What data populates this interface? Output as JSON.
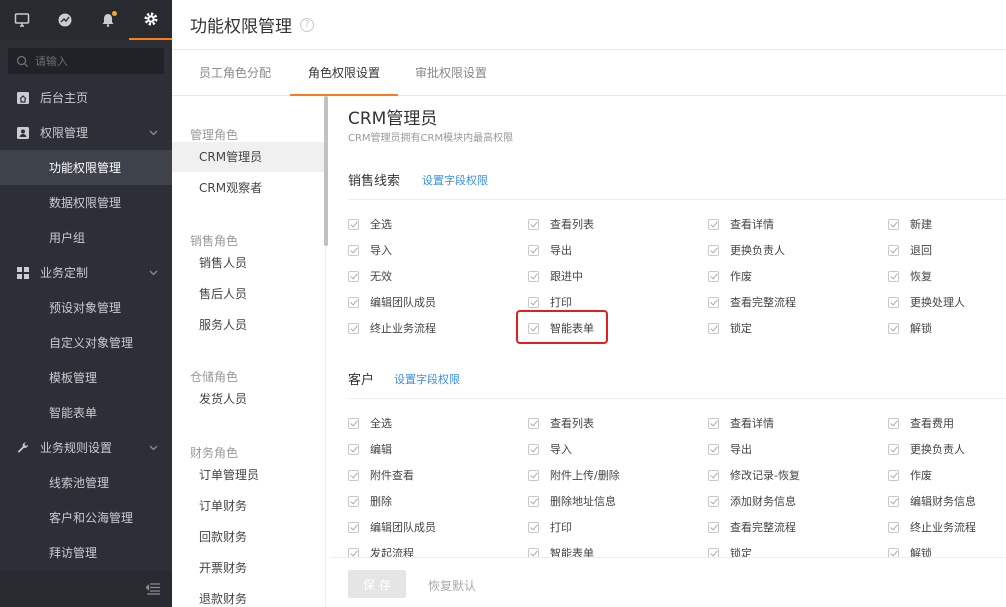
{
  "search": {
    "placeholder": "请输入"
  },
  "top_icons": [
    "monitor-icon",
    "chart-icon",
    "bell-icon",
    "gear-icon"
  ],
  "sidebar": {
    "items": [
      {
        "label": "后台主页",
        "icon": "home-icon"
      },
      {
        "label": "权限管理",
        "icon": "user-icon",
        "expandable": true
      },
      {
        "label": "功能权限管理",
        "sub": true,
        "active": true
      },
      {
        "label": "数据权限管理",
        "sub": true
      },
      {
        "label": "用户组",
        "sub": true
      },
      {
        "label": "业务定制",
        "icon": "grid-icon",
        "expandable": true
      },
      {
        "label": "预设对象管理",
        "sub": true
      },
      {
        "label": "自定义对象管理",
        "sub": true
      },
      {
        "label": "模板管理",
        "sub": true
      },
      {
        "label": "智能表单",
        "sub": true
      },
      {
        "label": "业务规则设置",
        "icon": "wrench-icon",
        "expandable": true
      },
      {
        "label": "线索池管理",
        "sub": true
      },
      {
        "label": "客户和公海管理",
        "sub": true
      },
      {
        "label": "拜访管理",
        "sub": true
      }
    ]
  },
  "header": {
    "title": "功能权限管理"
  },
  "tabs": [
    {
      "label": "员工角色分配"
    },
    {
      "label": "角色权限设置",
      "active": true
    },
    {
      "label": "审批权限设置"
    }
  ],
  "roles": {
    "groups": [
      {
        "title": "管理角色",
        "items": [
          "CRM管理员",
          "CRM观察者"
        ]
      },
      {
        "title": "销售角色",
        "items": [
          "销售人员",
          "售后人员",
          "服务人员"
        ]
      },
      {
        "title": "仓储角色",
        "items": [
          "发货人员"
        ]
      },
      {
        "title": "财务角色",
        "items": [
          "订单管理员",
          "订单财务",
          "回款财务",
          "开票财务",
          "退款财务"
        ]
      }
    ]
  },
  "detail": {
    "role_title": "CRM管理员",
    "role_desc": "CRM管理员拥有CRM模块内最高权限",
    "sections": [
      {
        "title": "销售线索",
        "link": "设置字段权限",
        "perms": [
          [
            "全选",
            "查看列表",
            "查看详情",
            "新建"
          ],
          [
            "导入",
            "导出",
            "更换负责人",
            "退回"
          ],
          [
            "无效",
            "跟进中",
            "作废",
            "恢复"
          ],
          [
            "编辑团队成员",
            "打印",
            "查看完整流程",
            "更换处理人"
          ],
          [
            "终止业务流程",
            "智能表单",
            "锁定",
            "解锁"
          ]
        ]
      },
      {
        "title": "客户",
        "link": "设置字段权限",
        "perms": [
          [
            "全选",
            "查看列表",
            "查看详情",
            "查看费用"
          ],
          [
            "编辑",
            "导入",
            "导出",
            "更换负责人"
          ],
          [
            "附件查看",
            "附件上传/删除",
            "修改记录-恢复",
            "作废"
          ],
          [
            "删除",
            "删除地址信息",
            "添加财务信息",
            "编辑财务信息"
          ],
          [
            "编辑团队成员",
            "打印",
            "查看完整流程",
            "终止业务流程"
          ],
          [
            "发起流程",
            "智能表单",
            "锁定",
            "解锁"
          ]
        ]
      }
    ]
  },
  "footer": {
    "save": "保 存",
    "reset": "恢复默认"
  },
  "colors": {
    "accent": "#ff7a1a",
    "link": "#3a8ee6",
    "highlight": "#e02020",
    "sidebar_bg": "#2c2f35"
  }
}
